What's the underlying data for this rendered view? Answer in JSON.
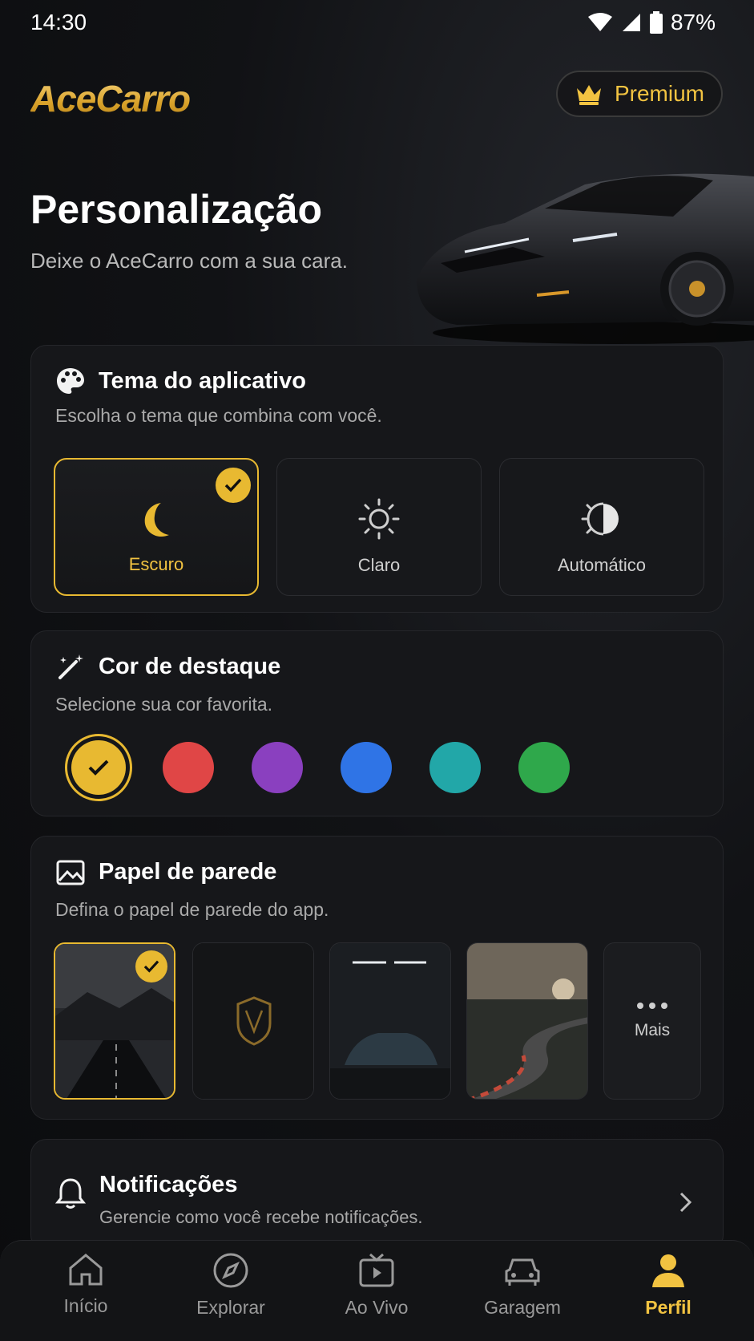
{
  "status_bar": {
    "time": "14:30",
    "battery": "87%"
  },
  "header": {
    "logo": "AceCarro",
    "premium_label": "Premium"
  },
  "hero": {
    "title": "Personalização",
    "subtitle": "Deixe o AceCarro com a sua cara."
  },
  "theme_card": {
    "title": "Tema do aplicativo",
    "subtitle": "Escolha o tema que combina com você.",
    "options": [
      {
        "label": "Escuro",
        "selected": true
      },
      {
        "label": "Claro",
        "selected": false
      },
      {
        "label": "Automático",
        "selected": false
      }
    ]
  },
  "accent_card": {
    "title": "Cor de destaque",
    "subtitle": "Selecione sua cor favorita.",
    "colors": [
      {
        "name": "gold",
        "hex": "#e8b931",
        "selected": true
      },
      {
        "name": "red",
        "hex": "#e04646",
        "selected": false
      },
      {
        "name": "purple",
        "hex": "#8a40bf",
        "selected": false
      },
      {
        "name": "blue",
        "hex": "#2f74e6",
        "selected": false
      },
      {
        "name": "teal",
        "hex": "#22a7a8",
        "selected": false
      },
      {
        "name": "green",
        "hex": "#2fa84b",
        "selected": false
      }
    ]
  },
  "wallpaper_card": {
    "title": "Papel de parede",
    "subtitle": "Defina o papel de parede do app.",
    "more_label": "Mais"
  },
  "notifications": {
    "title": "Notificações",
    "subtitle": "Gerencie como você recebe notificações."
  },
  "bottom_nav": {
    "items": [
      {
        "label": "Início",
        "active": false
      },
      {
        "label": "Explorar",
        "active": false
      },
      {
        "label": "Ao Vivo",
        "active": false
      },
      {
        "label": "Garagem",
        "active": false
      },
      {
        "label": "Perfil",
        "active": true
      }
    ]
  },
  "colors": {
    "accent": "#e8b931",
    "background": "#0c0d0f",
    "card": "#16171a"
  }
}
